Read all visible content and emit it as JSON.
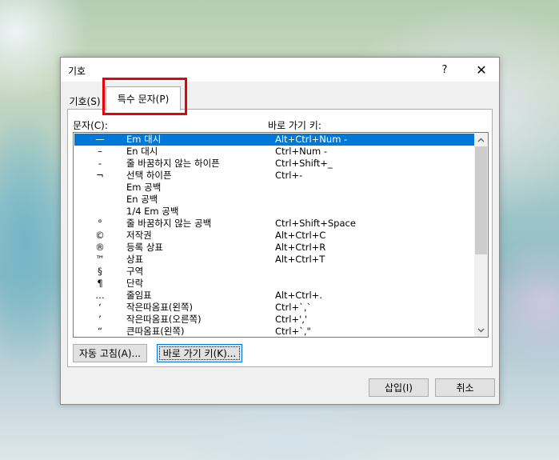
{
  "dialog": {
    "title": "기호",
    "help_label": "?",
    "close_label": "✕"
  },
  "tabs": [
    {
      "label": "기호(S)",
      "active": false
    },
    {
      "label": "특수 문자(P)",
      "active": true
    }
  ],
  "labels": {
    "characters": "문자(C):",
    "shortcut": "바로 가기 키:"
  },
  "list": {
    "selected_index": 0,
    "items": [
      {
        "symbol": "—",
        "name": "Em 대시",
        "shortcut": "Alt+Ctrl+Num -"
      },
      {
        "symbol": "–",
        "name": "En 대시",
        "shortcut": "Ctrl+Num -"
      },
      {
        "symbol": "-",
        "name": "줄 바꿈하지 않는 하이픈",
        "shortcut": "Ctrl+Shift+_"
      },
      {
        "symbol": "¬",
        "name": "선택 하이픈",
        "shortcut": "Ctrl+-"
      },
      {
        "symbol": "",
        "name": "Em 공백",
        "shortcut": ""
      },
      {
        "symbol": "",
        "name": "En 공백",
        "shortcut": ""
      },
      {
        "symbol": "",
        "name": "1/4 Em 공백",
        "shortcut": ""
      },
      {
        "symbol": "°",
        "name": "줄 바꿈하지 않는 공백",
        "shortcut": "Ctrl+Shift+Space"
      },
      {
        "symbol": "©",
        "name": "저작권",
        "shortcut": "Alt+Ctrl+C"
      },
      {
        "symbol": "®",
        "name": "등록 상표",
        "shortcut": "Alt+Ctrl+R"
      },
      {
        "symbol": "™",
        "name": "상표",
        "shortcut": "Alt+Ctrl+T"
      },
      {
        "symbol": "§",
        "name": "구역",
        "shortcut": ""
      },
      {
        "symbol": "¶",
        "name": "단락",
        "shortcut": ""
      },
      {
        "symbol": "…",
        "name": "줄임표",
        "shortcut": "Alt+Ctrl+."
      },
      {
        "symbol": "‘",
        "name": "작은따옴표(왼쪽)",
        "shortcut": "Ctrl+`,`"
      },
      {
        "symbol": "’",
        "name": "작은따옴표(오른쪽)",
        "shortcut": "Ctrl+','"
      },
      {
        "symbol": "“",
        "name": "큰따옴표(왼쪽)",
        "shortcut": "Ctrl+`,\""
      }
    ]
  },
  "scroll": {
    "up_icon": "▲",
    "down_icon": "▼"
  },
  "buttons": {
    "autocorrect": "자동 고침(A)...",
    "shortcut_key": "바로 가기 키(K)...",
    "insert": "삽입(I)",
    "cancel": "취소"
  },
  "colors": {
    "selection": "#0078d7",
    "highlight_box": "#e8000b"
  }
}
